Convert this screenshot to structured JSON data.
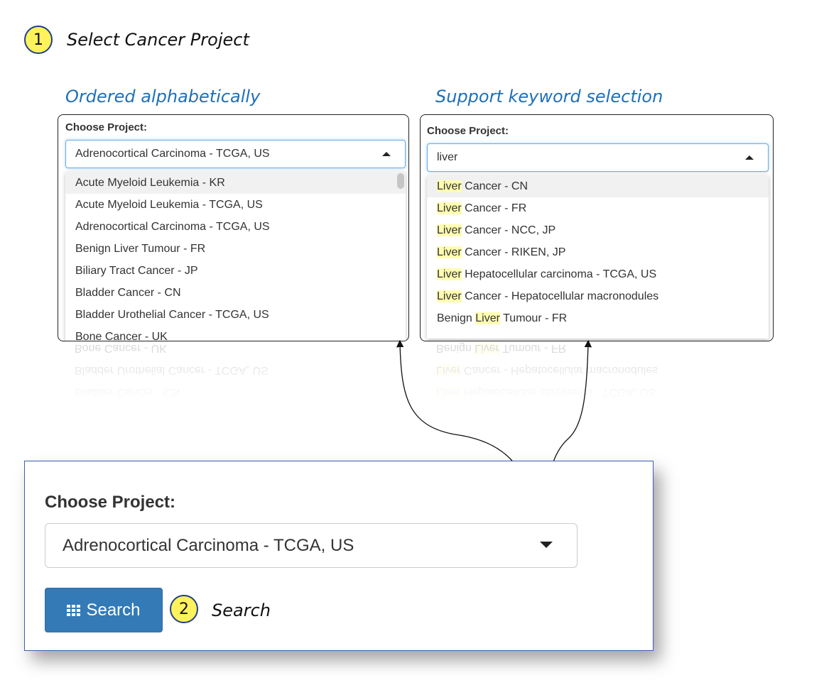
{
  "step1": {
    "number": "1",
    "label": "Select Cancer Project"
  },
  "step2": {
    "number": "2",
    "label": "Search"
  },
  "left_panel": {
    "caption": "Ordered alphabetically",
    "label": "Choose Project:",
    "selected": "Adrenocortical Carcinoma - TCGA, US",
    "options": [
      "Acute Myeloid Leukemia - KR",
      "Acute Myeloid Leukemia - TCGA, US",
      "Adrenocortical Carcinoma - TCGA, US",
      "Benign Liver Tumour - FR",
      "Biliary Tract Cancer - JP",
      "Bladder Cancer - CN",
      "Bladder Urothelial Cancer - TCGA, US",
      "Bone Cancer - UK"
    ]
  },
  "right_panel": {
    "caption": "Support keyword selection",
    "label": "Choose Project:",
    "search_value": "liver",
    "options": [
      {
        "pre": "",
        "match": "Liver",
        "post": " Cancer - CN"
      },
      {
        "pre": "",
        "match": "Liver",
        "post": " Cancer - FR"
      },
      {
        "pre": "",
        "match": "Liver",
        "post": " Cancer - NCC, JP"
      },
      {
        "pre": "",
        "match": "Liver",
        "post": " Cancer - RIKEN, JP"
      },
      {
        "pre": "",
        "match": "Liver",
        "post": " Hepatocellular carcinoma - TCGA, US"
      },
      {
        "pre": "",
        "match": "Liver",
        "post": " Cancer - Hepatocellular macronodules"
      },
      {
        "pre": "Benign ",
        "match": "Liver",
        "post": " Tumour - FR"
      }
    ]
  },
  "main_form": {
    "label": "Choose Project:",
    "selected": "Adrenocortical Carcinoma - TCGA, US",
    "search_button": "Search",
    "search_icon": "th-grid-icon"
  },
  "colors": {
    "accent_blue": "#1f6fb8",
    "button_blue": "#337ab7",
    "badge_yellow": "#fff25a",
    "highlight_yellow": "#fffdb0"
  }
}
